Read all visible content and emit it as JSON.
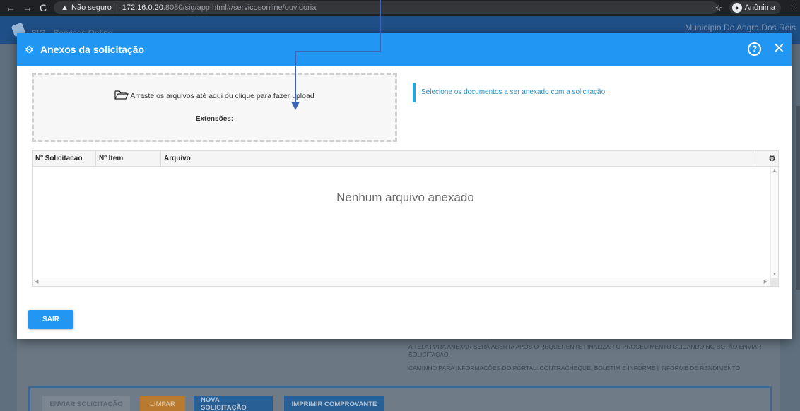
{
  "browser": {
    "security_label": "Não seguro",
    "url_host": "172.16.0.20",
    "url_path": ":8080/sig/app.html#/servicosonline/ouvidoria",
    "profile": "Anônima"
  },
  "app": {
    "name": "SIG - Serviços Online",
    "municipio": "Município De Angra Dos Reis"
  },
  "modal": {
    "title": "Anexos da solicitação",
    "dropzone_text": "Arraste os arquivos até aqui ou clique para fazer upload",
    "extensions_label": "Extensões:",
    "info_text": "Selecione os documentos a ser anexado com a solicitação.",
    "columns": [
      "Nº Solicitacao",
      "Nº Item",
      "Arquivo"
    ],
    "empty_text": "Nenhum arquivo anexado",
    "exit_button": "SAIR"
  },
  "background": {
    "note1": "A TELA PARA ANEXAR SERÁ ABERTA APÓS O REQUERENTE FINALIZAR O PROCEDIMENTO CLICANDO NO BOTÃO ENVIAR SOLICITAÇÃO.",
    "note2": "CAMINHO PARA INFORMAÇÕES DO PORTAL: CONTRACHEQUE, BOLETIM E INFORME | INFORME DE RENDIMENTO",
    "buttons": [
      "ENVIAR SOLICITAÇÃO",
      "LIMPAR",
      "NOVA SOLICITAÇÃO",
      "IMPRIMIR COMPROVANTE"
    ]
  },
  "colors": {
    "modal_header": "#2196f3",
    "info_accent": "#29a6d9",
    "annotation_arrow": "#3b63b8"
  }
}
